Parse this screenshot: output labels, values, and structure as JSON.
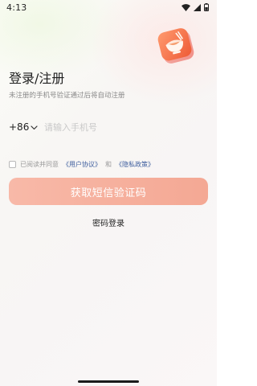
{
  "status_bar": {
    "time": "4:13",
    "icons": [
      "wifi-icon",
      "signal-icon",
      "battery-icon"
    ]
  },
  "header": {
    "logo": "app-logo-bowl-icon",
    "title": "登录/注册",
    "subtitle": "未注册的手机号验证通过后将自动注册"
  },
  "phone": {
    "country_code": "+86",
    "placeholder": "请输入手机号",
    "value": ""
  },
  "agreement": {
    "checked": false,
    "prefix": "已阅读并同意",
    "user_agreement": "《用户协议》",
    "conjunction": "和",
    "privacy_policy": "《隐私政策》"
  },
  "actions": {
    "sms_button_label": "获取短信验证码",
    "password_login_label": "密码登录"
  },
  "colors": {
    "primary_button": "#f6b09e",
    "link": "#3f5f9e",
    "logo_orange": "#f26b3c"
  }
}
